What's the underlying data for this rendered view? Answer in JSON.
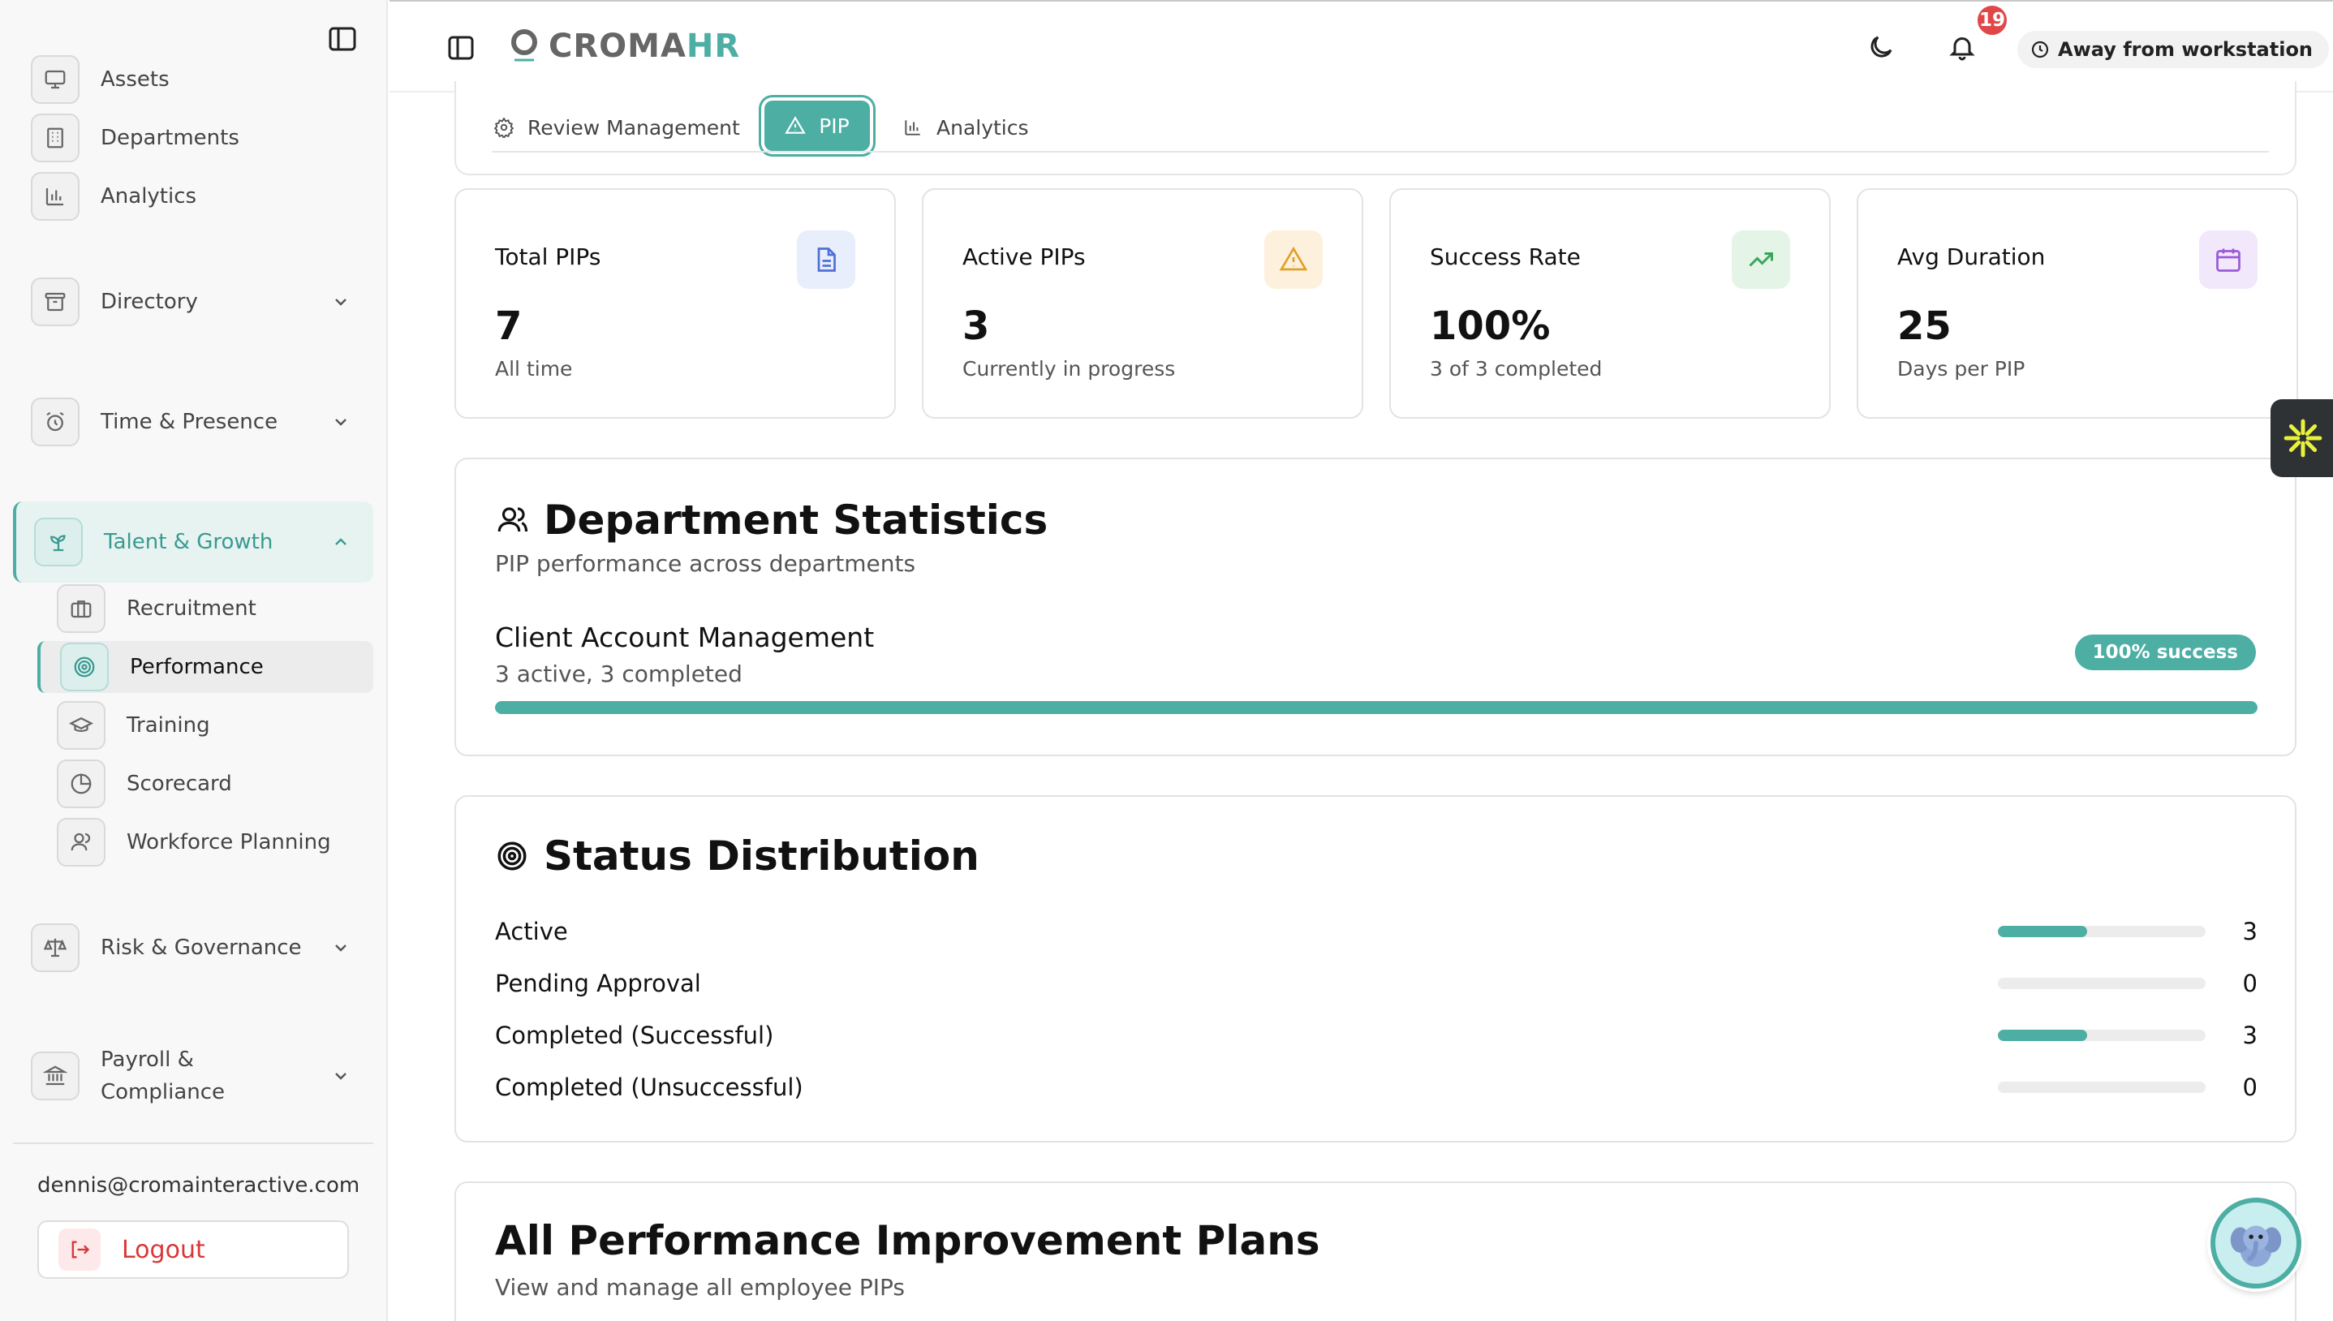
{
  "sidebar": {
    "items_top": [
      {
        "label": "Assets",
        "icon": "monitor-icon"
      },
      {
        "label": "Departments",
        "icon": "building-icon"
      },
      {
        "label": "Analytics",
        "icon": "bar-chart-icon"
      }
    ],
    "groups": [
      {
        "label": "Directory",
        "icon": "archive-icon"
      },
      {
        "label": "Time & Presence",
        "icon": "alarm-clock-icon"
      },
      {
        "label": "Talent & Growth",
        "icon": "sprout-icon"
      },
      {
        "label": "Risk & Governance",
        "icon": "scale-icon"
      },
      {
        "label": "Payroll &",
        "label2": "Compliance",
        "icon": "bank-icon"
      }
    ],
    "talent_sub": [
      {
        "label": "Recruitment",
        "icon": "briefcase-icon"
      },
      {
        "label": "Performance",
        "icon": "target-icon"
      },
      {
        "label": "Training",
        "icon": "graduation-cap-icon"
      },
      {
        "label": "Scorecard",
        "icon": "pie-chart-icon"
      },
      {
        "label": "Workforce Planning",
        "icon": "users-icon"
      }
    ],
    "email": "dennis@cromainteractive.com",
    "logout_label": "Logout"
  },
  "header": {
    "logo_croma": "CROMA",
    "logo_hr": "HR",
    "notification_count": "19",
    "status_label": "Away from workstation"
  },
  "tabs": [
    {
      "label": "Review Management",
      "icon": "gear-icon"
    },
    {
      "label": "PIP",
      "icon": "alert-triangle-icon",
      "active": true
    },
    {
      "label": "Analytics",
      "icon": "bar-chart-icon"
    }
  ],
  "stats": [
    {
      "title": "Total PIPs",
      "value": "7",
      "sub": "All time",
      "icon": "document-icon",
      "color": "#4f6fd8",
      "bg": "#e8eefc"
    },
    {
      "title": "Active PIPs",
      "value": "3",
      "sub": "Currently in progress",
      "icon": "alert-triangle-icon",
      "color": "#e0a02a",
      "bg": "#fdf1dd"
    },
    {
      "title": "Success Rate",
      "value": "100%",
      "sub": "3 of 3 completed",
      "icon": "trending-up-icon",
      "color": "#3aa65a",
      "bg": "#e4f5e8"
    },
    {
      "title": "Avg Duration",
      "value": "25",
      "sub": "Days per PIP",
      "icon": "calendar-icon",
      "color": "#9a5ad8",
      "bg": "#f2e8fc"
    }
  ],
  "department_stats": {
    "title": "Department Statistics",
    "subtitle": "PIP performance across departments",
    "rows": [
      {
        "name": "Client Account Management",
        "detail": "3 active, 3 completed",
        "badge": "100% success",
        "progress": 1.0
      }
    ]
  },
  "status_distribution": {
    "title": "Status Distribution",
    "rows": [
      {
        "label": "Active",
        "count": "3",
        "fraction": 0.43
      },
      {
        "label": "Pending Approval",
        "count": "0",
        "fraction": 0
      },
      {
        "label": "Completed (Successful)",
        "count": "3",
        "fraction": 0.43
      },
      {
        "label": "Completed (Unsuccessful)",
        "count": "0",
        "fraction": 0
      }
    ]
  },
  "all_pips": {
    "title": "All Performance Improvement Plans",
    "subtitle": "View and manage all employee PIPs"
  },
  "colors": {
    "accent": "#4daea4",
    "danger": "#d93636",
    "badge_red": "#e04848"
  }
}
